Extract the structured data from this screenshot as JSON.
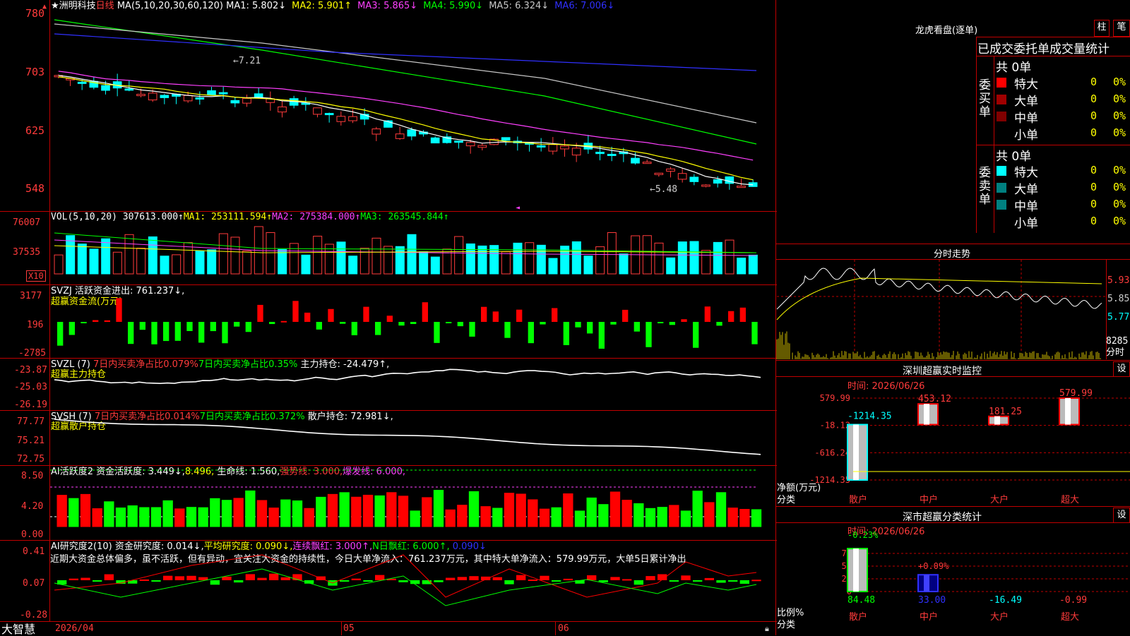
{
  "main_chart": {
    "star": "★",
    "stock_name": "洲明科技",
    "period": "日线",
    "ma_label": "MA(5,10,20,30,60,120)",
    "ma_values": [
      {
        "text": "MA1: 5.802↓",
        "color": "#ffffff"
      },
      {
        "text": "MA2: 5.901↑",
        "color": "#ffff00"
      },
      {
        "text": "MA3: 5.865↓",
        "color": "#ff40ff"
      },
      {
        "text": "MA4: 5.990↓",
        "color": "#00ff00"
      },
      {
        "text": "MA5: 6.324↓",
        "color": "#c8c8c8"
      },
      {
        "text": "MA6: 7.006↓",
        "color": "#3030ff"
      }
    ],
    "y_ticks": [
      "780",
      "703",
      "625",
      "548"
    ],
    "high_note": "←7.21",
    "low_note": "←5.48"
  },
  "vol_panel": {
    "label": "VOL(5,10,20)",
    "value": "307613.000↑",
    "ma1": "MA1: 253111.594↑",
    "ma2": "MA2: 275384.000↑",
    "ma3": "MA3: 263545.844↑",
    "y_ticks": [
      "76007",
      "37535"
    ],
    "unit": "X10"
  },
  "svzj_panel": {
    "label": "SVZJ  活跃资金进出: 761.237↓,",
    "sub": "超赢资金流(万元)",
    "y_ticks": [
      "3177",
      "196",
      "-2785"
    ]
  },
  "svzl_panel": {
    "label": "SVZL (7)",
    "a": "7日内买卖净占比0.079%",
    "b": "7日内买卖净占比0.35%",
    "c": "主力持仓: -24.479↑,",
    "sub": "超赢主力持仓",
    "y_ticks": [
      "-23.87",
      "-25.03",
      "-26.19"
    ]
  },
  "svsh_panel": {
    "label": "SVSH (7)",
    "a": "7日内买卖净占比0.014%",
    "b": "7日内买卖净占比0.372%",
    "c": "散户持仓: 72.981↓,",
    "sub": "超赢散户持仓",
    "y_ticks": [
      "77.77",
      "75.21",
      "72.75"
    ]
  },
  "ai_active_panel": {
    "label": "AI活跃度2",
    "a": "资金活跃度: 3.449↓,",
    "b": "8.496,",
    "c": "生命线: 1.560,",
    "d": "强势线: 3.000,",
    "e": "爆发线: 6.000,",
    "y_ticks": [
      "8.50",
      "4.20",
      "0.00"
    ]
  },
  "ai_research_panel": {
    "label": "AI研究度2(10)",
    "a": "资金研究度: 0.014↓,",
    "b": "平均研究度: 0.090↓,",
    "c": "连续飘红: 3.000↑,",
    "d": "N日飘红: 6.000↑,",
    "e": "0.090↓",
    "comment": "近期大资金总体偏多，虽不活跃，但有异动，宜关注大资金的持续性，今日大单净流入：761.237万元，其中特大单净流入：579.99万元，大单5日累计净出",
    "y_ticks": [
      "0.41",
      "0.07",
      "-0.28"
    ]
  },
  "bottom_bar": {
    "app_name": "大智慧",
    "date_start": "2026/04",
    "m05": "05",
    "m06": "06"
  },
  "dragon_tiger": {
    "title": "龙虎看盘(逐单)",
    "btn_zhu": "柱",
    "btn_bi": "笔",
    "subtitle": "已成交委托单成交量统计",
    "buy_side": "委买单",
    "sell_side": "委卖单",
    "buy_total": "共 0单",
    "sell_total": "共 0单",
    "buy_rows": [
      {
        "name": "特大",
        "count": "0",
        "pct": "0%",
        "color": "#ff0000"
      },
      {
        "name": "大单",
        "count": "0",
        "pct": "0%",
        "color": "#a00000"
      },
      {
        "name": "中单",
        "count": "0",
        "pct": "0%",
        "color": "#800000"
      },
      {
        "name": "小单",
        "count": "0",
        "pct": "0%",
        "color": ""
      }
    ],
    "sell_rows": [
      {
        "name": "特大",
        "count": "0",
        "pct": "0%",
        "color": "#00ffff"
      },
      {
        "name": "大单",
        "count": "0",
        "pct": "0%",
        "color": "#008080"
      },
      {
        "name": "中单",
        "count": "0",
        "pct": "0%",
        "color": "#008080"
      },
      {
        "name": "小单",
        "count": "0",
        "pct": "0%",
        "color": ""
      }
    ]
  },
  "intraday": {
    "title": "分时走势",
    "prices": [
      "5.93",
      "5.85",
      "5.77"
    ],
    "vol": "8285",
    "vol_unit": "分时"
  },
  "sz_monitor": {
    "title": "深圳超赢实时监控",
    "settings": "设",
    "time_label": "时间: 2026/06/26",
    "y_ticks": [
      "579.99",
      "-18.12",
      "-616.24",
      "-1214.35"
    ],
    "y_unit": "净额(万元)",
    "x_unit": "分类",
    "bars": [
      {
        "name": "散户",
        "value": -1214.35,
        "label": "-1214.35",
        "label_color": "#00ffff"
      },
      {
        "name": "中户",
        "value": 453.12,
        "label": "453.12",
        "label_color": "#ff3b3b"
      },
      {
        "name": "大户",
        "value": 181.25,
        "label": "181.25",
        "label_color": "#ff3b3b"
      },
      {
        "name": "超大",
        "value": 579.99,
        "label": "579.99",
        "label_color": "#ff3b3b"
      }
    ]
  },
  "sz_classify": {
    "title": "深市超赢分类统计",
    "settings": "设",
    "time_label": "时间: 2026/06/26",
    "y_ticks": [
      "75",
      "50",
      "25",
      "0"
    ],
    "y_unit": "比例%",
    "x_unit": "分类",
    "top_labels": [
      "-0.23%",
      "+0.09%"
    ],
    "bars": [
      {
        "name": "散户",
        "value": 84.48,
        "label": "84.48",
        "label_color": "#00ff00"
      },
      {
        "name": "中户",
        "value": 33.0,
        "label": "33.00",
        "label_color": "#3030ff"
      },
      {
        "name": "大户",
        "value": -16.49,
        "label": "-16.49",
        "label_color": "#00ffff"
      },
      {
        "name": "超大",
        "value": -0.99,
        "label": "-0.99",
        "label_color": "#ff3b3b"
      }
    ]
  },
  "chart_data": [
    {
      "type": "bar",
      "title": "深圳超赢实时监控",
      "categories": [
        "散户",
        "中户",
        "大户",
        "超大"
      ],
      "values": [
        -1214.35,
        453.12,
        181.25,
        579.99
      ],
      "ylabel": "净额(万元)",
      "xlabel": "分类",
      "ylim": [
        -1214.35,
        579.99
      ]
    },
    {
      "type": "bar",
      "title": "深市超赢分类统计",
      "categories": [
        "散户",
        "中户",
        "大户",
        "超大"
      ],
      "values": [
        84.48,
        33.0,
        -16.49,
        -0.99
      ],
      "ylabel": "比例%",
      "xlabel": "分类",
      "ylim": [
        0,
        100
      ]
    }
  ]
}
